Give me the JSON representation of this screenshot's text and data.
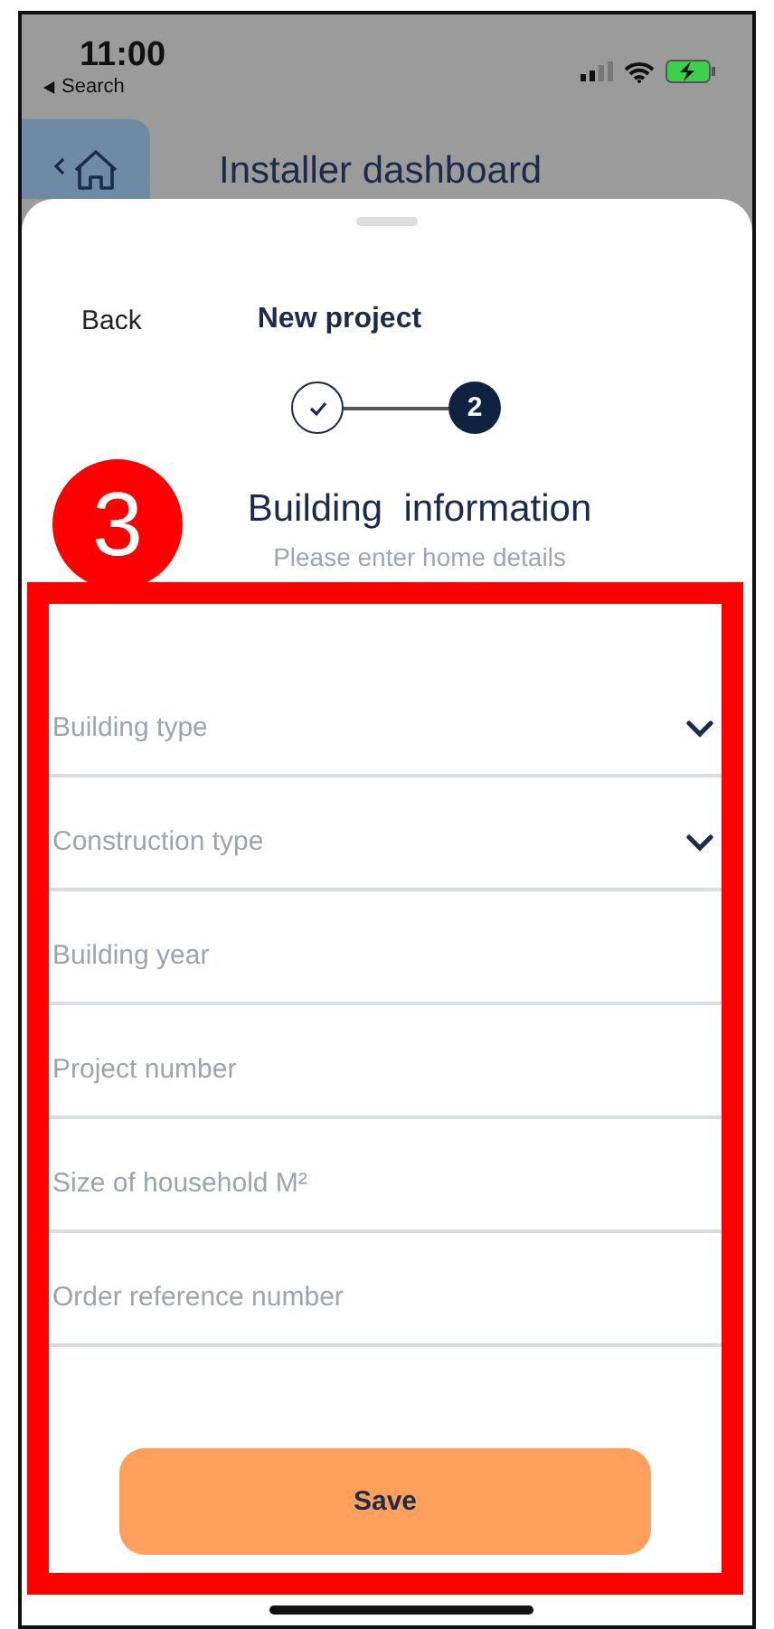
{
  "status_bar": {
    "time": "11:00",
    "back_app": "Search"
  },
  "header": {
    "title": "Installer dashboard"
  },
  "sheet": {
    "back": "Back",
    "title": "New project",
    "steps": [
      {
        "kind": "done"
      },
      {
        "kind": "current",
        "label": "2"
      }
    ],
    "section_title": "Building  information",
    "section_subtitle": "Please enter home details",
    "fields": [
      {
        "kind": "select",
        "placeholder": "Building type"
      },
      {
        "kind": "select",
        "placeholder": "Construction type"
      },
      {
        "kind": "text",
        "placeholder": "Building year"
      },
      {
        "kind": "text",
        "placeholder": "Project number"
      },
      {
        "kind": "text",
        "placeholder": "Size of household M²"
      },
      {
        "kind": "text",
        "placeholder": "Order reference number"
      }
    ],
    "save_button": "Save"
  },
  "annotation": {
    "badge": "3"
  }
}
